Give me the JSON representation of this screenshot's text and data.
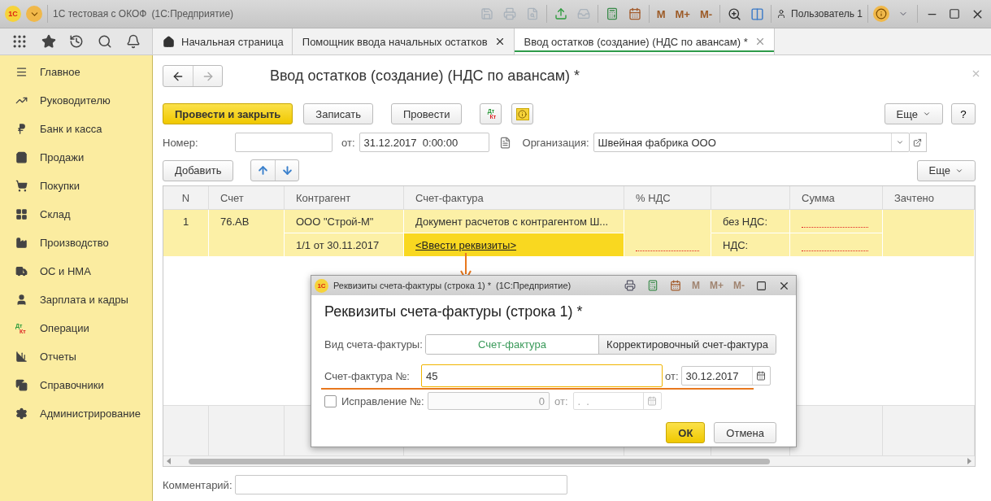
{
  "window": {
    "logo": "1С",
    "title": "1С тестовая с ОКОФ",
    "subtitle": "(1С:Предприятие)",
    "memory_buttons": [
      {
        "label": "M",
        "disabled": false
      },
      {
        "label": "M+",
        "disabled": false
      },
      {
        "label": "M-",
        "disabled": false
      }
    ],
    "user": "Пользователь 1"
  },
  "tabs": [
    {
      "label": "Начальная страница",
      "selected": false,
      "closable": false,
      "home": true
    },
    {
      "label": "Помощник ввода начальных остатков",
      "selected": false,
      "closable": true,
      "home": false
    },
    {
      "label": "Ввод остатков (создание) (НДС по авансам) *",
      "selected": true,
      "closable": true,
      "home": false
    }
  ],
  "sidebar": {
    "items": [
      {
        "label": "Главное"
      },
      {
        "label": "Руководителю"
      },
      {
        "label": "Банк и касса"
      },
      {
        "label": "Продажи"
      },
      {
        "label": "Покупки"
      },
      {
        "label": "Склад"
      },
      {
        "label": "Производство"
      },
      {
        "label": "ОС и НМА"
      },
      {
        "label": "Зарплата и кадры"
      },
      {
        "label": "Операции",
        "icon_text": [
          "Дт",
          "Кт"
        ]
      },
      {
        "label": "Отчеты"
      },
      {
        "label": "Справочники"
      },
      {
        "label": "Администрирование"
      }
    ]
  },
  "form": {
    "title": "Ввод остатков (создание) (НДС по авансам) *",
    "commands": [
      {
        "label": "Провести и закрыть",
        "kind": "primary"
      },
      {
        "label": "Записать",
        "kind": "normal"
      },
      {
        "label": "Провести",
        "kind": "normal"
      }
    ],
    "dtkt": [
      "Дт",
      "Кт"
    ],
    "more": "Еще",
    "help": "?",
    "number_label": "Номер:",
    "date_label": "от:",
    "date_value": "31.12.2017  0:00:00",
    "org_label": "Организация:",
    "org_value": "Швейная фабрика ООО",
    "add": "Добавить",
    "table_more": "Еще",
    "comment_label": "Комментарий:"
  },
  "table": {
    "columns": [
      {
        "kind": "text",
        "label": "N"
      },
      {
        "kind": "text",
        "label": "Счет"
      },
      {
        "kind": "text",
        "label": "Контрагент"
      },
      {
        "kind": "text",
        "label": "Счет-фактура"
      },
      {
        "kind": "text",
        "label": "% НДС"
      },
      {
        "kind": "blank"
      },
      {
        "kind": "text",
        "label": "Сумма"
      },
      {
        "kind": "text",
        "label": "Зачтено"
      }
    ],
    "rows": [
      {
        "n": "1",
        "account": "76.АВ",
        "counterparty": "ООО \"Строй-М\"",
        "counterparty_doc": "1/1 от 30.11.2017",
        "invoice": "Документ расчетов с контрагентом Ш...",
        "invoice_link": "<Ввести реквизиты>",
        "link_selected": true,
        "base_label": "без НДС:",
        "vat_label": "НДС:"
      }
    ]
  },
  "dialog": {
    "logo": "1С",
    "title": "Реквизиты счета-фактуры (строка 1) *",
    "app": "(1С:Предприятие)",
    "memory_buttons": [
      {
        "label": "M",
        "disabled": true
      },
      {
        "label": "M+",
        "disabled": true
      },
      {
        "label": "M-",
        "disabled": true
      }
    ],
    "heading": "Реквизиты счета-фактуры (строка 1) *",
    "type_label": "Вид счета-фактуры:",
    "types": [
      {
        "label": "Счет-фактура",
        "selected": true
      },
      {
        "label": "Корректировочный счет-фактура",
        "selected": false
      }
    ],
    "number_label": "Счет-фактура №:",
    "number_value": "45",
    "number_focused": true,
    "date_label": "от:",
    "date_value": "30.12.2017",
    "correction": {
      "label": "Исправление №:",
      "checked": false,
      "value": "0",
      "date_label": "от:",
      "date_value": ".  ."
    },
    "buttons": [
      {
        "label": "ОК",
        "kind": "primary"
      },
      {
        "label": "Отмена",
        "kind": "normal"
      }
    ]
  }
}
